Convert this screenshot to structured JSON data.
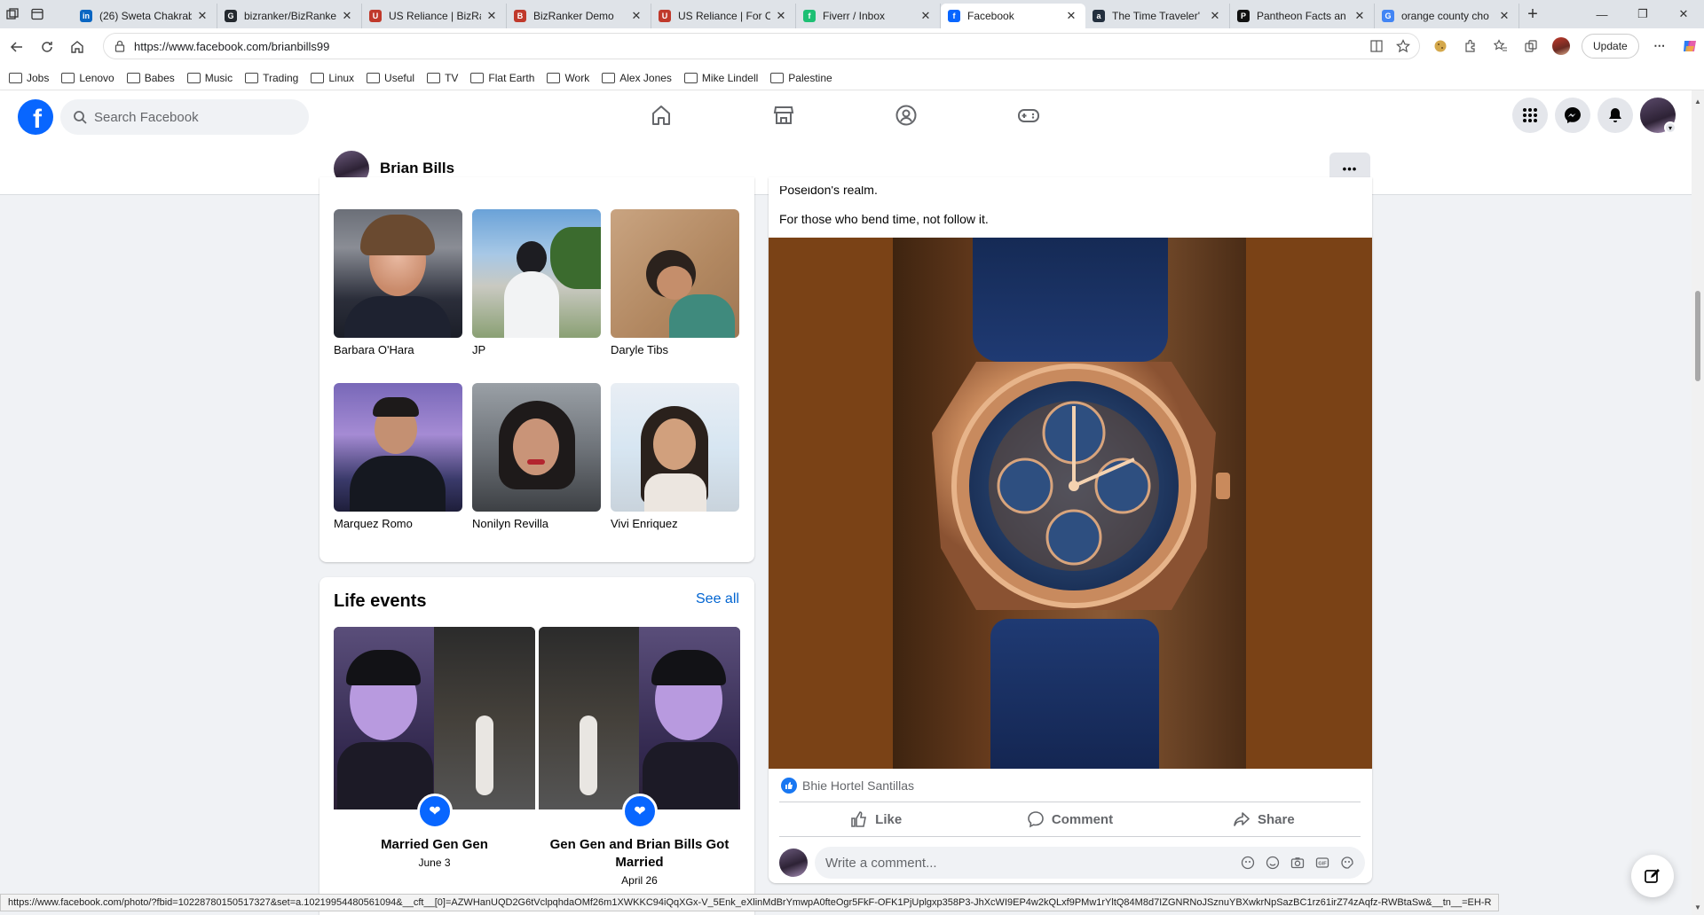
{
  "browser": {
    "tabs": [
      {
        "title": "(26) Sweta Chakrab",
        "color": "#0a66c2",
        "glyph": "in"
      },
      {
        "title": "bizranker/BizRanke",
        "color": "#24292f",
        "glyph": "G"
      },
      {
        "title": "US Reliance | BizRa",
        "color": "#c0392b",
        "glyph": "U"
      },
      {
        "title": "BizRanker Demo",
        "color": "#c0392b",
        "glyph": "B"
      },
      {
        "title": "US Reliance | For C",
        "color": "#c0392b",
        "glyph": "U"
      },
      {
        "title": "Fiverr / Inbox",
        "color": "#1dbf73",
        "glyph": "f"
      },
      {
        "title": "Facebook",
        "color": "#0866ff",
        "glyph": "f"
      },
      {
        "title": "The Time Traveler'",
        "color": "#232f3e",
        "glyph": "a"
      },
      {
        "title": "Pantheon Facts an",
        "color": "#111111",
        "glyph": "P"
      },
      {
        "title": "orange county cho",
        "color": "#4285f4",
        "glyph": "G"
      }
    ],
    "url": "https://www.facebook.com/brianbills99",
    "update_label": "Update",
    "bookmarks": [
      "Jobs",
      "Lenovo",
      "Babes",
      "Music",
      "Trading",
      "Linux",
      "Useful",
      "TV",
      "Flat Earth",
      "Work",
      "Alex Jones",
      "Mike Lindell",
      "Palestine"
    ],
    "status_url": "https://www.facebook.com/photo/?fbid=10228780150517327&set=a.10219954480561094&__cft__[0]=AZWHanUQD2G6tVclpqhdaOMf26m1XWKKC94iQqXGx-V_5Enk_eXlinMdBrYmwpA0fteOgr5FkF-OFK1PjUplgxp358P3-JhXcWI9EP4w2kQLxf9PMw1rYltQ84M8d7IZGNRNoJSznuYBXwkrNpSazBC1rz61irZ74zAqfz-RWBtaSw&__tn__=EH-R"
  },
  "facebook": {
    "search_placeholder": "Search Facebook",
    "profile_name": "Brian Bills",
    "friends": [
      {
        "name": "Barbara O'Hara"
      },
      {
        "name": "JP"
      },
      {
        "name": "Daryle Tibs"
      },
      {
        "name": "Marquez Romo"
      },
      {
        "name": "Nonilyn Revilla"
      },
      {
        "name": "Vivi Enriquez"
      }
    ],
    "life_events": {
      "title": "Life events",
      "see_all": "See all",
      "items": [
        {
          "title": "Married Gen Gen",
          "date": "June 3"
        },
        {
          "title": "Gen Gen and Brian Bills Got Married",
          "date": "April 26"
        }
      ]
    },
    "post": {
      "text_partial": "Poseidon's realm.",
      "text_line": "For those who bend time, not follow it.",
      "reaction_name": "Bhie Hortel Santillas",
      "like_label": "Like",
      "comment_label": "Comment",
      "share_label": "Share",
      "comment_placeholder": "Write a comment..."
    }
  }
}
